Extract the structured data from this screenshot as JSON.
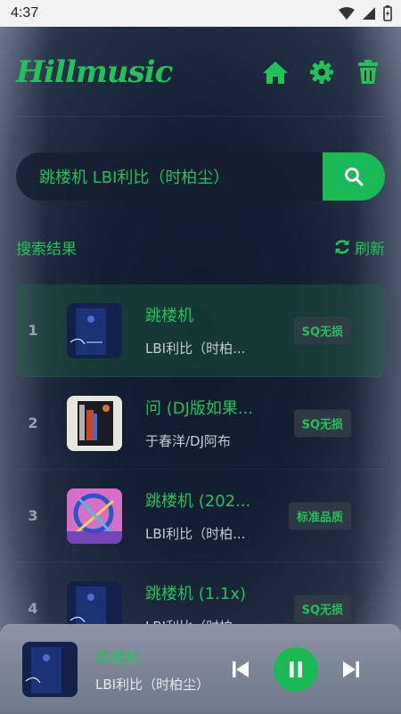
{
  "status_bar": {
    "time": "4:37"
  },
  "header": {
    "logo": "Hillmusic",
    "icons": [
      "home-icon",
      "gear-icon",
      "trash-icon"
    ]
  },
  "search": {
    "query": "跳楼机 LBI利比（时柏尘）",
    "button_icon": "search-icon"
  },
  "results": {
    "title": "搜索结果",
    "refresh_label": "刷新",
    "items": [
      {
        "index": "1",
        "title": "跳楼机",
        "artist": "LBI利比（时柏...",
        "quality": "SQ无损"
      },
      {
        "index": "2",
        "title": "问 (DJ版如果...",
        "artist": "于春洋/DJ阿布",
        "quality": "SQ无损"
      },
      {
        "index": "3",
        "title": "跳楼机 (202...",
        "artist": "LBI利比（时柏...",
        "quality": "标准品质"
      },
      {
        "index": "4",
        "title": "跳楼机 (1.1x)",
        "artist": "LBI利比（时柏...",
        "quality": "SQ无损"
      }
    ]
  },
  "player": {
    "title": "跳楼机",
    "artist": "LBI利比（时柏尘）",
    "icons": [
      "previous-icon",
      "pause-icon",
      "next-icon"
    ]
  },
  "colors": {
    "accent": "#22c25a",
    "accent_button": "#19b955"
  }
}
